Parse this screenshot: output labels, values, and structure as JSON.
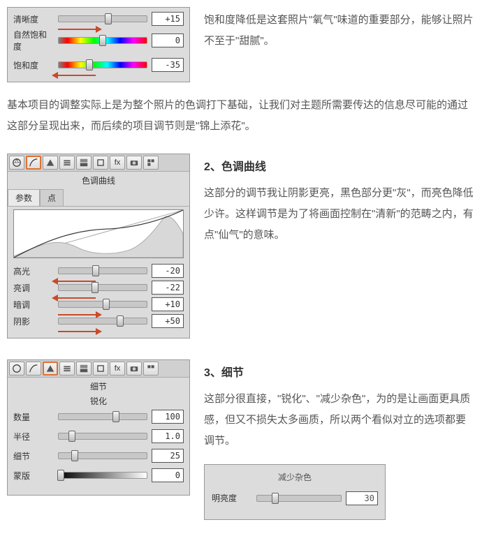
{
  "panel_top": {
    "sliders": [
      {
        "label": "清晰度",
        "value": "+15",
        "knob": 56,
        "arrow": "right",
        "track": "plain"
      },
      {
        "label": "自然饱和度",
        "value": "0",
        "knob": 50,
        "arrow": "right",
        "track": "hue"
      },
      {
        "label": "饱和度",
        "value": "-35",
        "knob": 35,
        "arrow": "left",
        "track": "hue"
      }
    ]
  },
  "desc_top": "饱和度降低是这套照片\"氧气\"味道的重要部分，能够让照片不至于\"甜腻\"。",
  "para_mid": "基本项目的调整实际上是为整个照片的色调打下基础，让我们对主题所需要传达的信息尽可能的通过这部分呈现出来，而后续的项目调节则是\"锦上添花\"。",
  "section2": {
    "heading": "2、色调曲线",
    "desc": "这部分的调节我让阴影更亮，黑色部分更\"灰\"，而亮色降低少许。这样调节是为了将画面控制在\"清新\"的范畴之内，有点\"仙气\"的意味。",
    "panel_title": "色调曲线",
    "tabs": {
      "param": "参数",
      "point": "点"
    },
    "sliders": [
      {
        "label": "高光",
        "value": "-20",
        "knob": 42,
        "arrow": "left"
      },
      {
        "label": "亮调",
        "value": "-22",
        "knob": 41,
        "arrow": "left"
      },
      {
        "label": "暗调",
        "value": "+10",
        "knob": 54,
        "arrow": "right"
      },
      {
        "label": "阴影",
        "value": "+50",
        "knob": 70,
        "arrow": "right"
      }
    ]
  },
  "section3": {
    "heading": "3、细节",
    "desc": "这部分很直接，\"锐化\"、\"减少杂色\"，为的是让画面更具质感，但又不损失太多画质，所以两个看似对立的选项都要调节。",
    "panel_title": "细节",
    "sub_title": "锐化",
    "sliders": [
      {
        "label": "数量",
        "value": "100",
        "knob": 65
      },
      {
        "label": "半径",
        "value": "1.0",
        "knob": 15
      },
      {
        "label": "细节",
        "value": "25",
        "knob": 18
      },
      {
        "label": "蒙版",
        "value": "0",
        "knob": 2
      }
    ],
    "noise": {
      "title": "减少杂色",
      "slider": {
        "label": "明亮度",
        "value": "30",
        "knob": 22
      }
    }
  }
}
